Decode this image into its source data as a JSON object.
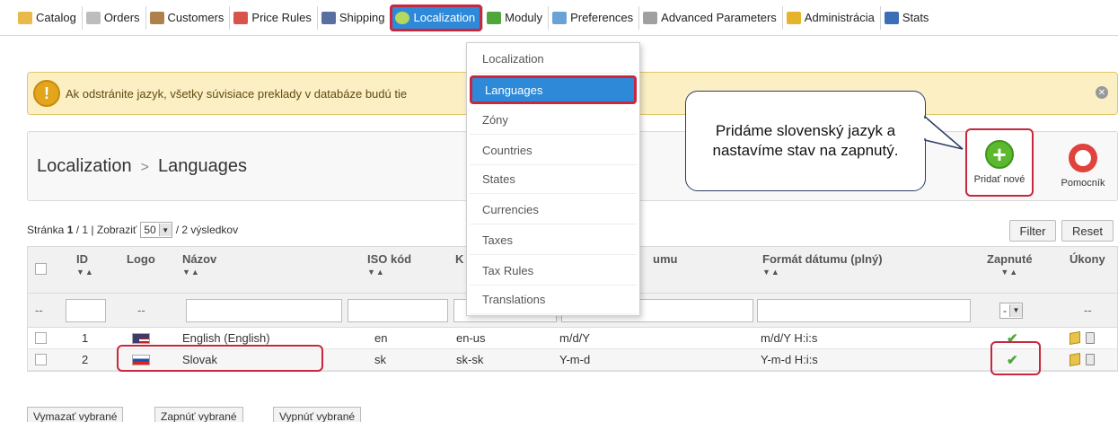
{
  "menu": {
    "items": [
      {
        "label": "Catalog",
        "icon": "folder-icon",
        "color": "#e9b94a"
      },
      {
        "label": "Orders",
        "icon": "orders-icon",
        "color": "#8a8a8a"
      },
      {
        "label": "Customers",
        "icon": "customers-icon",
        "color": "#b0804a"
      },
      {
        "label": "Price Rules",
        "icon": "price-rules-icon",
        "color": "#d8544a"
      },
      {
        "label": "Shipping",
        "icon": "truck-icon",
        "color": "#5870a0"
      },
      {
        "label": "Localization",
        "icon": "globe-icon",
        "color": "#b4d860",
        "active": true
      },
      {
        "label": "Moduly",
        "icon": "puzzle-icon",
        "color": "#4fa63a"
      },
      {
        "label": "Preferences",
        "icon": "preferences-icon",
        "color": "#6aa2d6"
      },
      {
        "label": "Advanced Parameters",
        "icon": "wrench-icon",
        "color": "#a0a0a0"
      },
      {
        "label": "Administrácia",
        "icon": "key-icon",
        "color": "#e6b42a"
      },
      {
        "label": "Stats",
        "icon": "stats-icon",
        "color": "#3b6fb6"
      }
    ]
  },
  "dropdown": {
    "items": [
      {
        "label": "Localization"
      },
      {
        "label": "Languages",
        "active": true
      },
      {
        "label": "Zóny"
      },
      {
        "label": "Countries"
      },
      {
        "label": "States"
      },
      {
        "label": "Currencies"
      },
      {
        "label": "Taxes"
      },
      {
        "label": "Tax Rules"
      },
      {
        "label": "Translations"
      }
    ]
  },
  "warning": {
    "icon": "!",
    "text": "Ak odstránite jazyk, všetky súvisiace preklady v databáze budú tie"
  },
  "title": {
    "section": "Localization",
    "separator": ">",
    "page": "Languages"
  },
  "toolbar": {
    "add_label": "Pridať nové",
    "help_label": "Pomocník"
  },
  "callout": {
    "text": "Pridáme slovenský jazyk a nastavíme stav na zapnutý."
  },
  "pagination": {
    "prefix": "Stránka",
    "page": "1",
    "total_pages": "/ 1 | Zobraziť",
    "per_page": "50",
    "results": "/ 2 výsledkov"
  },
  "filters": {
    "filter_label": "Filter",
    "reset_label": "Reset"
  },
  "table": {
    "headers": {
      "id": "ID",
      "logo": "Logo",
      "name": "Názov",
      "iso": "ISO kód",
      "code": "K",
      "date_format": "umu",
      "date_format_full": "Formát dátumu (plný)",
      "active": "Zapnuté",
      "actions": "Úkony"
    },
    "filter_placeholder_dash": "--",
    "active_filter_value": "-",
    "rows": [
      {
        "id": "1",
        "flag": "us-flag-icon",
        "name": "English (English)",
        "iso": "en",
        "code": "en-us",
        "date_format": "m/d/Y",
        "date_format_full": "m/d/Y H:i:s"
      },
      {
        "id": "2",
        "flag": "sk-flag-icon",
        "name": "Slovak",
        "iso": "sk",
        "code": "sk-sk",
        "date_format": "Y-m-d",
        "date_format_full": "Y-m-d H:i:s"
      }
    ]
  },
  "bulk": {
    "delete_label": "Vymazať vybrané",
    "enable_label": "Zapnúť vybrané",
    "disable_label": "Vypnúť vybrané"
  },
  "colors": {
    "accent": "#2e8ad8",
    "highlight": "#c8273d",
    "success": "#4fa63a",
    "warning_bg": "#fbefc3"
  }
}
